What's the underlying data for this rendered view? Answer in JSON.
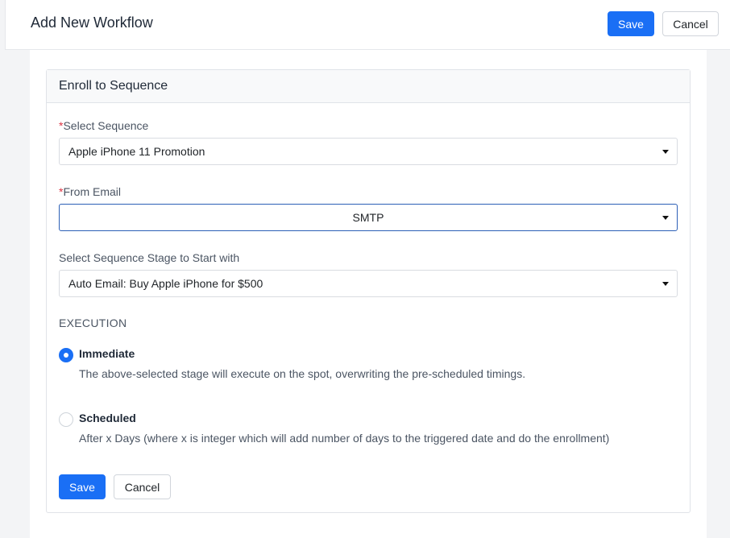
{
  "header": {
    "title": "Add New Workflow",
    "save_label": "Save",
    "cancel_label": "Cancel"
  },
  "card": {
    "title": "Enroll to Sequence",
    "required_marker": "*",
    "sequence": {
      "label": "Select Sequence",
      "value": "Apple iPhone 11 Promotion"
    },
    "from_email": {
      "label": "From Email",
      "value": "SMTP"
    },
    "stage": {
      "label": "Select Sequence Stage to Start with",
      "value": "Auto Email: Buy Apple iPhone for $500"
    },
    "execution": {
      "heading": "EXECUTION",
      "options": [
        {
          "title": "Immediate",
          "description": "The above-selected stage will execute on the spot, overwriting the pre-scheduled timings.",
          "selected": true
        },
        {
          "title": "Scheduled",
          "description": "After x Days (where x is integer which will add number of days to the triggered date and do the enrollment)",
          "selected": false
        }
      ]
    },
    "save_label": "Save",
    "cancel_label": "Cancel"
  },
  "colors": {
    "primary": "#1a6ff5",
    "required": "#dc3545",
    "focus_border": "#2c5fb6"
  }
}
